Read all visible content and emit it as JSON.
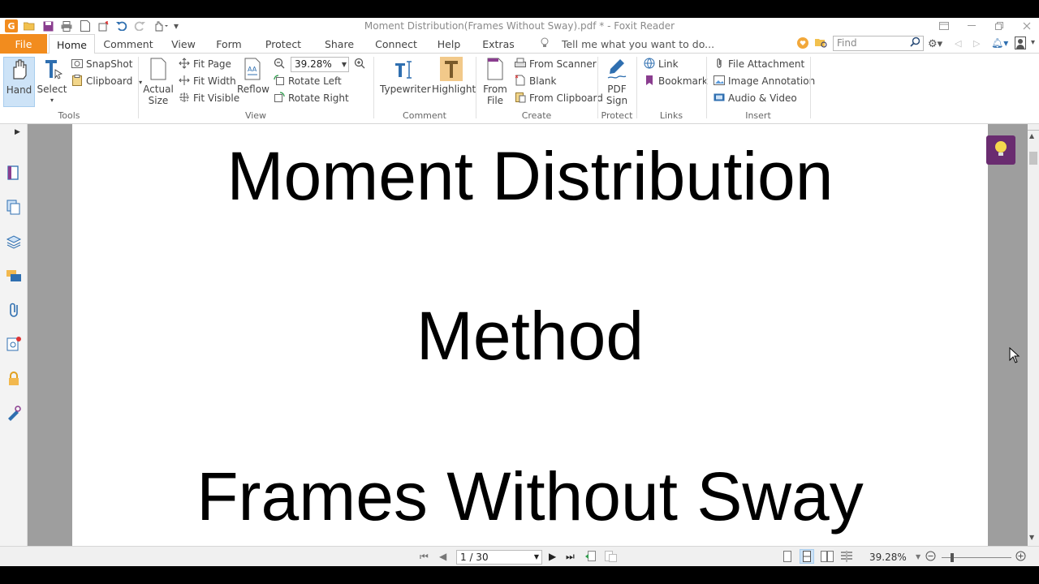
{
  "window": {
    "title": "Moment Distribution(Frames Without Sway).pdf * - Foxit Reader",
    "app_logo": "G"
  },
  "tabs": [
    {
      "label": "File"
    },
    {
      "label": "Home"
    },
    {
      "label": "Comment"
    },
    {
      "label": "View"
    },
    {
      "label": "Form"
    },
    {
      "label": "Protect"
    },
    {
      "label": "Share"
    },
    {
      "label": "Connect"
    },
    {
      "label": "Help"
    },
    {
      "label": "Extras"
    }
  ],
  "tell_me": "Tell me what you want to do...",
  "search": {
    "placeholder": "Find"
  },
  "ribbon": {
    "tools": {
      "hand": "Hand",
      "select": "Select",
      "snapshot": "SnapShot",
      "clipboard": "Clipboard",
      "label": "Tools"
    },
    "view": {
      "actual_size_1": "Actual",
      "actual_size_2": "Size",
      "fit_page": "Fit Page",
      "fit_width": "Fit Width",
      "fit_visible": "Fit Visible",
      "reflow": "Reflow",
      "zoom_value": "39.28%",
      "rotate_left": "Rotate Left",
      "rotate_right": "Rotate Right",
      "label": "View"
    },
    "comment": {
      "typewriter": "Typewriter",
      "highlight": "Highlight",
      "label": "Comment"
    },
    "create": {
      "from_file_1": "From",
      "from_file_2": "File",
      "from_scanner": "From Scanner",
      "blank": "Blank",
      "from_clipboard": "From Clipboard",
      "label": "Create"
    },
    "protect": {
      "pdf_sign_1": "PDF",
      "pdf_sign_2": "Sign",
      "label": "Protect"
    },
    "links": {
      "link": "Link",
      "bookmark": "Bookmark",
      "label": "Links"
    },
    "insert": {
      "file_attachment": "File Attachment",
      "image_annotation": "Image Annotation",
      "audio_video": "Audio & Video",
      "label": "Insert"
    }
  },
  "document": {
    "line1": "Moment Distribution",
    "line2": "Method",
    "line3": "Frames Without Sway"
  },
  "status": {
    "page_indicator": "1 / 30",
    "zoom": "39.28%"
  },
  "colors": {
    "accent": "#f28c1e",
    "bulb": "#6a2c70",
    "doc_background": "#9e9e9e"
  }
}
